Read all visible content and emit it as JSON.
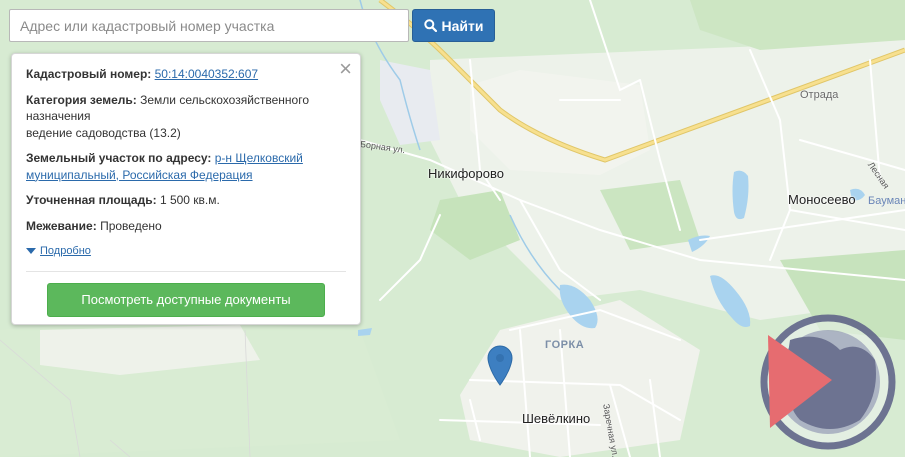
{
  "search": {
    "placeholder": "Адрес или кадастровый номер участка",
    "button_label": "Найти",
    "button_icon": "search-icon"
  },
  "info": {
    "cadastral_label": "Кадастровый номер:",
    "cadastral_value": "50:14:0040352:607",
    "category_label": "Категория земель:",
    "category_value_1": "Земли сельскохозяйственного назначения",
    "category_value_2": "ведение садоводства (13.2)",
    "address_label": "Земельный участок по адресу:",
    "address_value": "р-н Щелковский муниципальный, Российская Федерация",
    "area_label": "Уточненная площадь:",
    "area_value": "1 500 кв.м.",
    "survey_label": "Межевание:",
    "survey_value": "Проведено",
    "more_label": "Подробно",
    "docs_button": "Посмотреть доступные документы",
    "close_icon": "close-icon"
  },
  "map": {
    "places": {
      "nikiforovo": "Никифорово",
      "monoseevo": "Моносеево",
      "shevelkino": "Шевёлкино",
      "gorka": "ГОРКА",
      "otrada": "Отрада",
      "baumansk": "Бауман",
      "lesnaya": "Лесная",
      "bornaya": "Борная ул.",
      "zarechnaya": "Заречная ул."
    },
    "marker_icon": "map-pin-icon",
    "colors": {
      "forest": "#cfe8c6",
      "field": "#eef3ea",
      "road": "#ffffff",
      "main_road": "#f7e08f",
      "water": "#a9d3ef",
      "marker": "#3d7fc1"
    }
  },
  "logo": "globe-play-logo"
}
